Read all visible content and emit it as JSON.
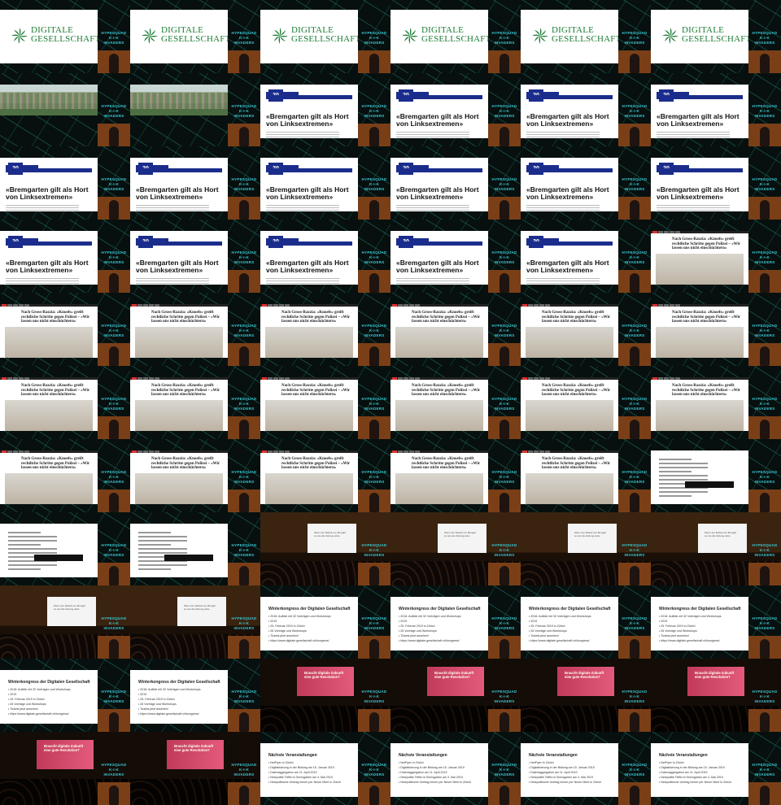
{
  "contact_sheet": {
    "title": "",
    "overlay_logo_text": "HYPESQUAD\nK-I-K\nINVADERS",
    "slides": {
      "dg": {
        "text_line1": "DIGITALE",
        "text_line2": "GESELLSCHAFT"
      },
      "news": {
        "headline": "«Bremgarten gilt als Hort von Linksextremen»"
      },
      "sg": {
        "headline": "Nach Gross-Razzia: «Knoefs» greift rechtliche Schritte gegen Polizei – «Wir lassen uns nicht einschüchtern»"
      },
      "hall": {
        "screen_text": "Wenn der Rebell von Morgart so wie die Zeitung wäre"
      },
      "wk": {
        "title": "Winterkongress der Digitalen Gesellschaft",
        "lines": [
          "• 2016: Aufklär mit 32 Vorträgen und Workshops",
          "• 2019",
          "  • 25. Februar 2019 in Zürich",
          "  • 26 Vorträge und Workshops",
          "  • Tickets jetzt ansehen!",
          "  • https://www.digitale-gesellschaft.ch/kongress/"
        ]
      },
      "stage": {
        "screen_text": "Braucht digitale Zukunft eine gute Revolution?"
      },
      "nv": {
        "title": "Nächste Veranstaltungen",
        "lines": [
          "• NetFlyer in Zürich",
          "  • Digitalisierung in der Bildung am 15. Januar 2019",
          "  • Datenaggregation am 11. April 2019",
          "• Netzpolitik Teffen in Bremgarten am 4. Mai 2019",
          "• Netzpolitische Umfrag immer per Neuer Miert in Zürich"
        ]
      }
    },
    "grid": [
      [
        "dg",
        "dg",
        "dg",
        "dg",
        "dg",
        "dg"
      ],
      [
        "scenic",
        "scenic",
        "news",
        "news",
        "news",
        "news"
      ],
      [
        "news",
        "news",
        "news",
        "news",
        "news",
        "news"
      ],
      [
        "news",
        "news",
        "news",
        "news",
        "news",
        "sg"
      ],
      [
        "sg",
        "sg",
        "sg",
        "sg",
        "sg",
        "sg"
      ],
      [
        "sg",
        "sg",
        "sg",
        "sg",
        "sg",
        "sg"
      ],
      [
        "sg",
        "sg",
        "sg",
        "sg",
        "sg",
        "doc"
      ],
      [
        "doc",
        "doc",
        "hall",
        "hall",
        "hall",
        "hall"
      ],
      [
        "hall",
        "hall",
        "wk",
        "wk",
        "wk",
        "wk"
      ],
      [
        "wk",
        "wk",
        "stage",
        "stage",
        "stage",
        "stage"
      ],
      [
        "stage",
        "stage",
        "nv",
        "nv",
        "nv",
        "nv"
      ]
    ],
    "colors": {
      "background": "#050608",
      "accent_logo": "#1e7d35",
      "overlay_logo": "#39c6d3",
      "news_blue": "#1b2d8c",
      "stage_screen": "#d94a6b"
    }
  }
}
